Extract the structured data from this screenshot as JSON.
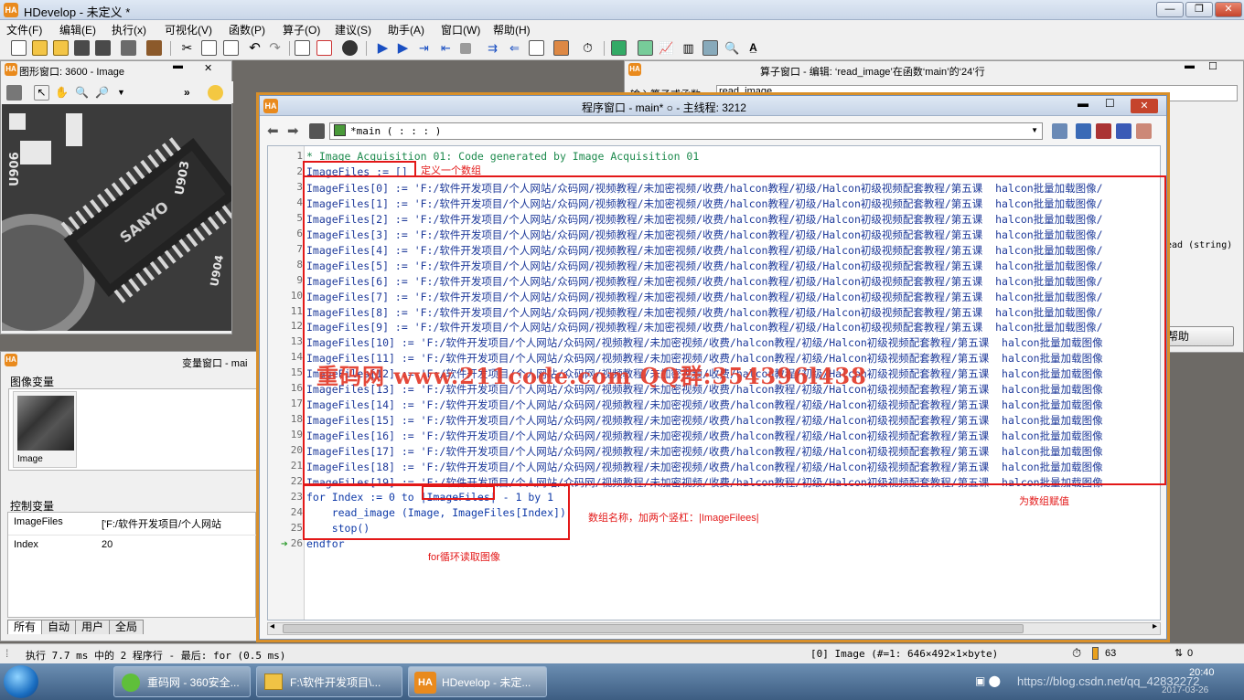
{
  "app": {
    "title": "HDevelop - 未定义 *",
    "logo": "HA"
  },
  "window_controls": {
    "minimize": "—",
    "maximize": "❐",
    "close": "✕"
  },
  "menu": [
    "文件(F)",
    "编辑(E)",
    "执行(x)",
    "可视化(V)",
    "函数(P)",
    "算子(O)",
    "建议(S)",
    "助手(A)",
    "窗口(W)",
    "帮助(H)"
  ],
  "graphics_window": {
    "title": "图形窗口: 3600 - Image",
    "nav_symbol": "»"
  },
  "operator_window": {
    "title": "算子窗口 - 编辑: ‘read_image’在函数‘main’的‘24’行",
    "input_label": "输入算子或函数",
    "input_value": "read_image",
    "partial_text": "ead (string)",
    "help_button": "帮助"
  },
  "variable_window": {
    "title": "变量窗口 - mai",
    "image_section": "图像变量",
    "image_var_name": "Image",
    "control_section": "控制变量",
    "control_vars": [
      {
        "name": "ImageFiles",
        "value": "['F:/软件开发项目/个人网站"
      },
      {
        "name": "Index",
        "value": "20"
      }
    ],
    "tabs": [
      "所有",
      "自动",
      "用户",
      "全局"
    ]
  },
  "program_window": {
    "title": "程序窗口 - main* ○ - 主线程: 3212",
    "procedure": "*main ( : : : )",
    "lines": [
      {
        "n": "1",
        "text": "* Image Acquisition 01: Code generated by Image Acquisition 01",
        "type": "comment"
      },
      {
        "n": "2",
        "text": "ImageFiles := []",
        "type": "code"
      },
      {
        "n": "3",
        "text": "ImageFiles[0] := 'F:/软件开发项目/个人网站/众码网/视频教程/未加密视频/收费/halcon教程/初级/Halcon初级视频配套教程/第五课  halcon批量加载图像/",
        "type": "code"
      },
      {
        "n": "4",
        "text": "ImageFiles[1] := 'F:/软件开发项目/个人网站/众码网/视频教程/未加密视频/收费/halcon教程/初级/Halcon初级视频配套教程/第五课  halcon批量加载图像/",
        "type": "code"
      },
      {
        "n": "5",
        "text": "ImageFiles[2] := 'F:/软件开发项目/个人网站/众码网/视频教程/未加密视频/收费/halcon教程/初级/Halcon初级视频配套教程/第五课  halcon批量加载图像/",
        "type": "code"
      },
      {
        "n": "6",
        "text": "ImageFiles[3] := 'F:/软件开发项目/个人网站/众码网/视频教程/未加密视频/收费/halcon教程/初级/Halcon初级视频配套教程/第五课  halcon批量加载图像/",
        "type": "code"
      },
      {
        "n": "7",
        "text": "ImageFiles[4] := 'F:/软件开发项目/个人网站/众码网/视频教程/未加密视频/收费/halcon教程/初级/Halcon初级视频配套教程/第五课  halcon批量加载图像/",
        "type": "code"
      },
      {
        "n": "8",
        "text": "ImageFiles[5] := 'F:/软件开发项目/个人网站/众码网/视频教程/未加密视频/收费/halcon教程/初级/Halcon初级视频配套教程/第五课  halcon批量加载图像/",
        "type": "code"
      },
      {
        "n": "9",
        "text": "ImageFiles[6] := 'F:/软件开发项目/个人网站/众码网/视频教程/未加密视频/收费/halcon教程/初级/Halcon初级视频配套教程/第五课  halcon批量加载图像/",
        "type": "code"
      },
      {
        "n": "10",
        "text": "ImageFiles[7] := 'F:/软件开发项目/个人网站/众码网/视频教程/未加密视频/收费/halcon教程/初级/Halcon初级视频配套教程/第五课  halcon批量加载图像/",
        "type": "code"
      },
      {
        "n": "11",
        "text": "ImageFiles[8] := 'F:/软件开发项目/个人网站/众码网/视频教程/未加密视频/收费/halcon教程/初级/Halcon初级视频配套教程/第五课  halcon批量加载图像/",
        "type": "code"
      },
      {
        "n": "12",
        "text": "ImageFiles[9] := 'F:/软件开发项目/个人网站/众码网/视频教程/未加密视频/收费/halcon教程/初级/Halcon初级视频配套教程/第五课  halcon批量加载图像/",
        "type": "code"
      },
      {
        "n": "13",
        "text": "ImageFiles[10] := 'F:/软件开发项目/个人网站/众码网/视频教程/未加密视频/收费/halcon教程/初级/Halcon初级视频配套教程/第五课  halcon批量加载图像",
        "type": "code"
      },
      {
        "n": "14",
        "text": "ImageFiles[11] := 'F:/软件开发项目/个人网站/众码网/视频教程/未加密视频/收费/halcon教程/初级/Halcon初级视频配套教程/第五课  halcon批量加载图像",
        "type": "code"
      },
      {
        "n": "15",
        "text": "ImageFiles[12] := 'F:/软件开发项目/个人网站/众码网/视频教程/未加密视频/收费/halcon教程/初级/Halcon初级视频配套教程/第五课  halcon批量加载图像",
        "type": "code"
      },
      {
        "n": "16",
        "text": "ImageFiles[13] := 'F:/软件开发项目/个人网站/众码网/视频教程/未加密视频/收费/halcon教程/初级/Halcon初级视频配套教程/第五课  halcon批量加载图像",
        "type": "code"
      },
      {
        "n": "17",
        "text": "ImageFiles[14] := 'F:/软件开发项目/个人网站/众码网/视频教程/未加密视频/收费/halcon教程/初级/Halcon初级视频配套教程/第五课  halcon批量加载图像",
        "type": "code"
      },
      {
        "n": "18",
        "text": "ImageFiles[15] := 'F:/软件开发项目/个人网站/众码网/视频教程/未加密视频/收费/halcon教程/初级/Halcon初级视频配套教程/第五课  halcon批量加载图像",
        "type": "code"
      },
      {
        "n": "19",
        "text": "ImageFiles[16] := 'F:/软件开发项目/个人网站/众码网/视频教程/未加密视频/收费/halcon教程/初级/Halcon初级视频配套教程/第五课  halcon批量加载图像",
        "type": "code"
      },
      {
        "n": "20",
        "text": "ImageFiles[17] := 'F:/软件开发项目/个人网站/众码网/视频教程/未加密视频/收费/halcon教程/初级/Halcon初级视频配套教程/第五课  halcon批量加载图像",
        "type": "code"
      },
      {
        "n": "21",
        "text": "ImageFiles[18] := 'F:/软件开发项目/个人网站/众码网/视频教程/未加密视频/收费/halcon教程/初级/Halcon初级视频配套教程/第五课  halcon批量加载图像",
        "type": "code"
      },
      {
        "n": "22",
        "text": "ImageFiles[19] := 'F:/软件开发项目/个人网站/众码网/视频教程/未加密视频/收费/halcon教程/初级/Halcon初级视频配套教程/第五课  halcon批量加载图像",
        "type": "code"
      },
      {
        "n": "23",
        "text": "for Index := 0 to |ImageFiles| - 1 by 1",
        "type": "kw"
      },
      {
        "n": "24",
        "text": "    read_image (Image, ImageFiles[Index])",
        "type": "kw"
      },
      {
        "n": "25",
        "text": "    stop()",
        "type": "kw"
      },
      {
        "n": "26",
        "text": "endfor",
        "type": "kw"
      }
    ]
  },
  "annotations": {
    "define_array": "定义一个数组",
    "assign_array": "为数组赋值",
    "array_name": "数组名称，加两个竖杠：|ImageFilees|",
    "for_loop": "for循环读取图像",
    "watermark": "重码网  www.211code.com   QQ群:354396l438"
  },
  "status": {
    "left": "执行 7.7 ms 中的 2 程序行 - 最后: for (0.5 ms)",
    "image_info": "[0] Image (#=1: 646×492×1×byte)",
    "count": "63",
    "right_value": "0"
  },
  "taskbar": {
    "tasks": [
      "重码网 - 360安全...",
      "F:\\软件开发项目\\...",
      "HDevelop - 未定..."
    ],
    "clock_time": "20:40",
    "clock_date": "2017-03-26",
    "url_overlay": "https://blog.csdn.net/qq_42832272"
  },
  "colors": {
    "accent": "#e31818",
    "frame": "#d88f2a",
    "comment": "#1d8a4d",
    "keyword": "#0f3aa8"
  }
}
